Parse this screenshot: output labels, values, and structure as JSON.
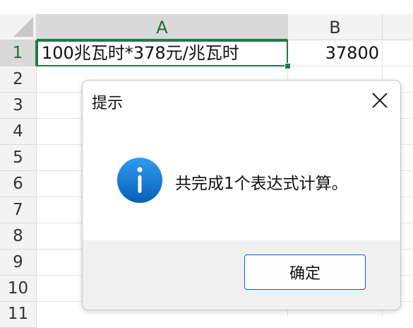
{
  "sheet": {
    "columns": [
      "A",
      "B"
    ],
    "rows": [
      "1",
      "2",
      "3",
      "4",
      "5",
      "6",
      "7",
      "8",
      "9",
      "10",
      "11"
    ],
    "cells": {
      "A1": "100兆瓦时*378元/兆瓦时",
      "B1": "37800"
    },
    "accent_color": "#1f7a45"
  },
  "dialog": {
    "title": "提示",
    "message": "共完成1个表达式计算。",
    "icon": "info-icon",
    "ok_label": "确定",
    "accent_color": "#0067c0"
  }
}
